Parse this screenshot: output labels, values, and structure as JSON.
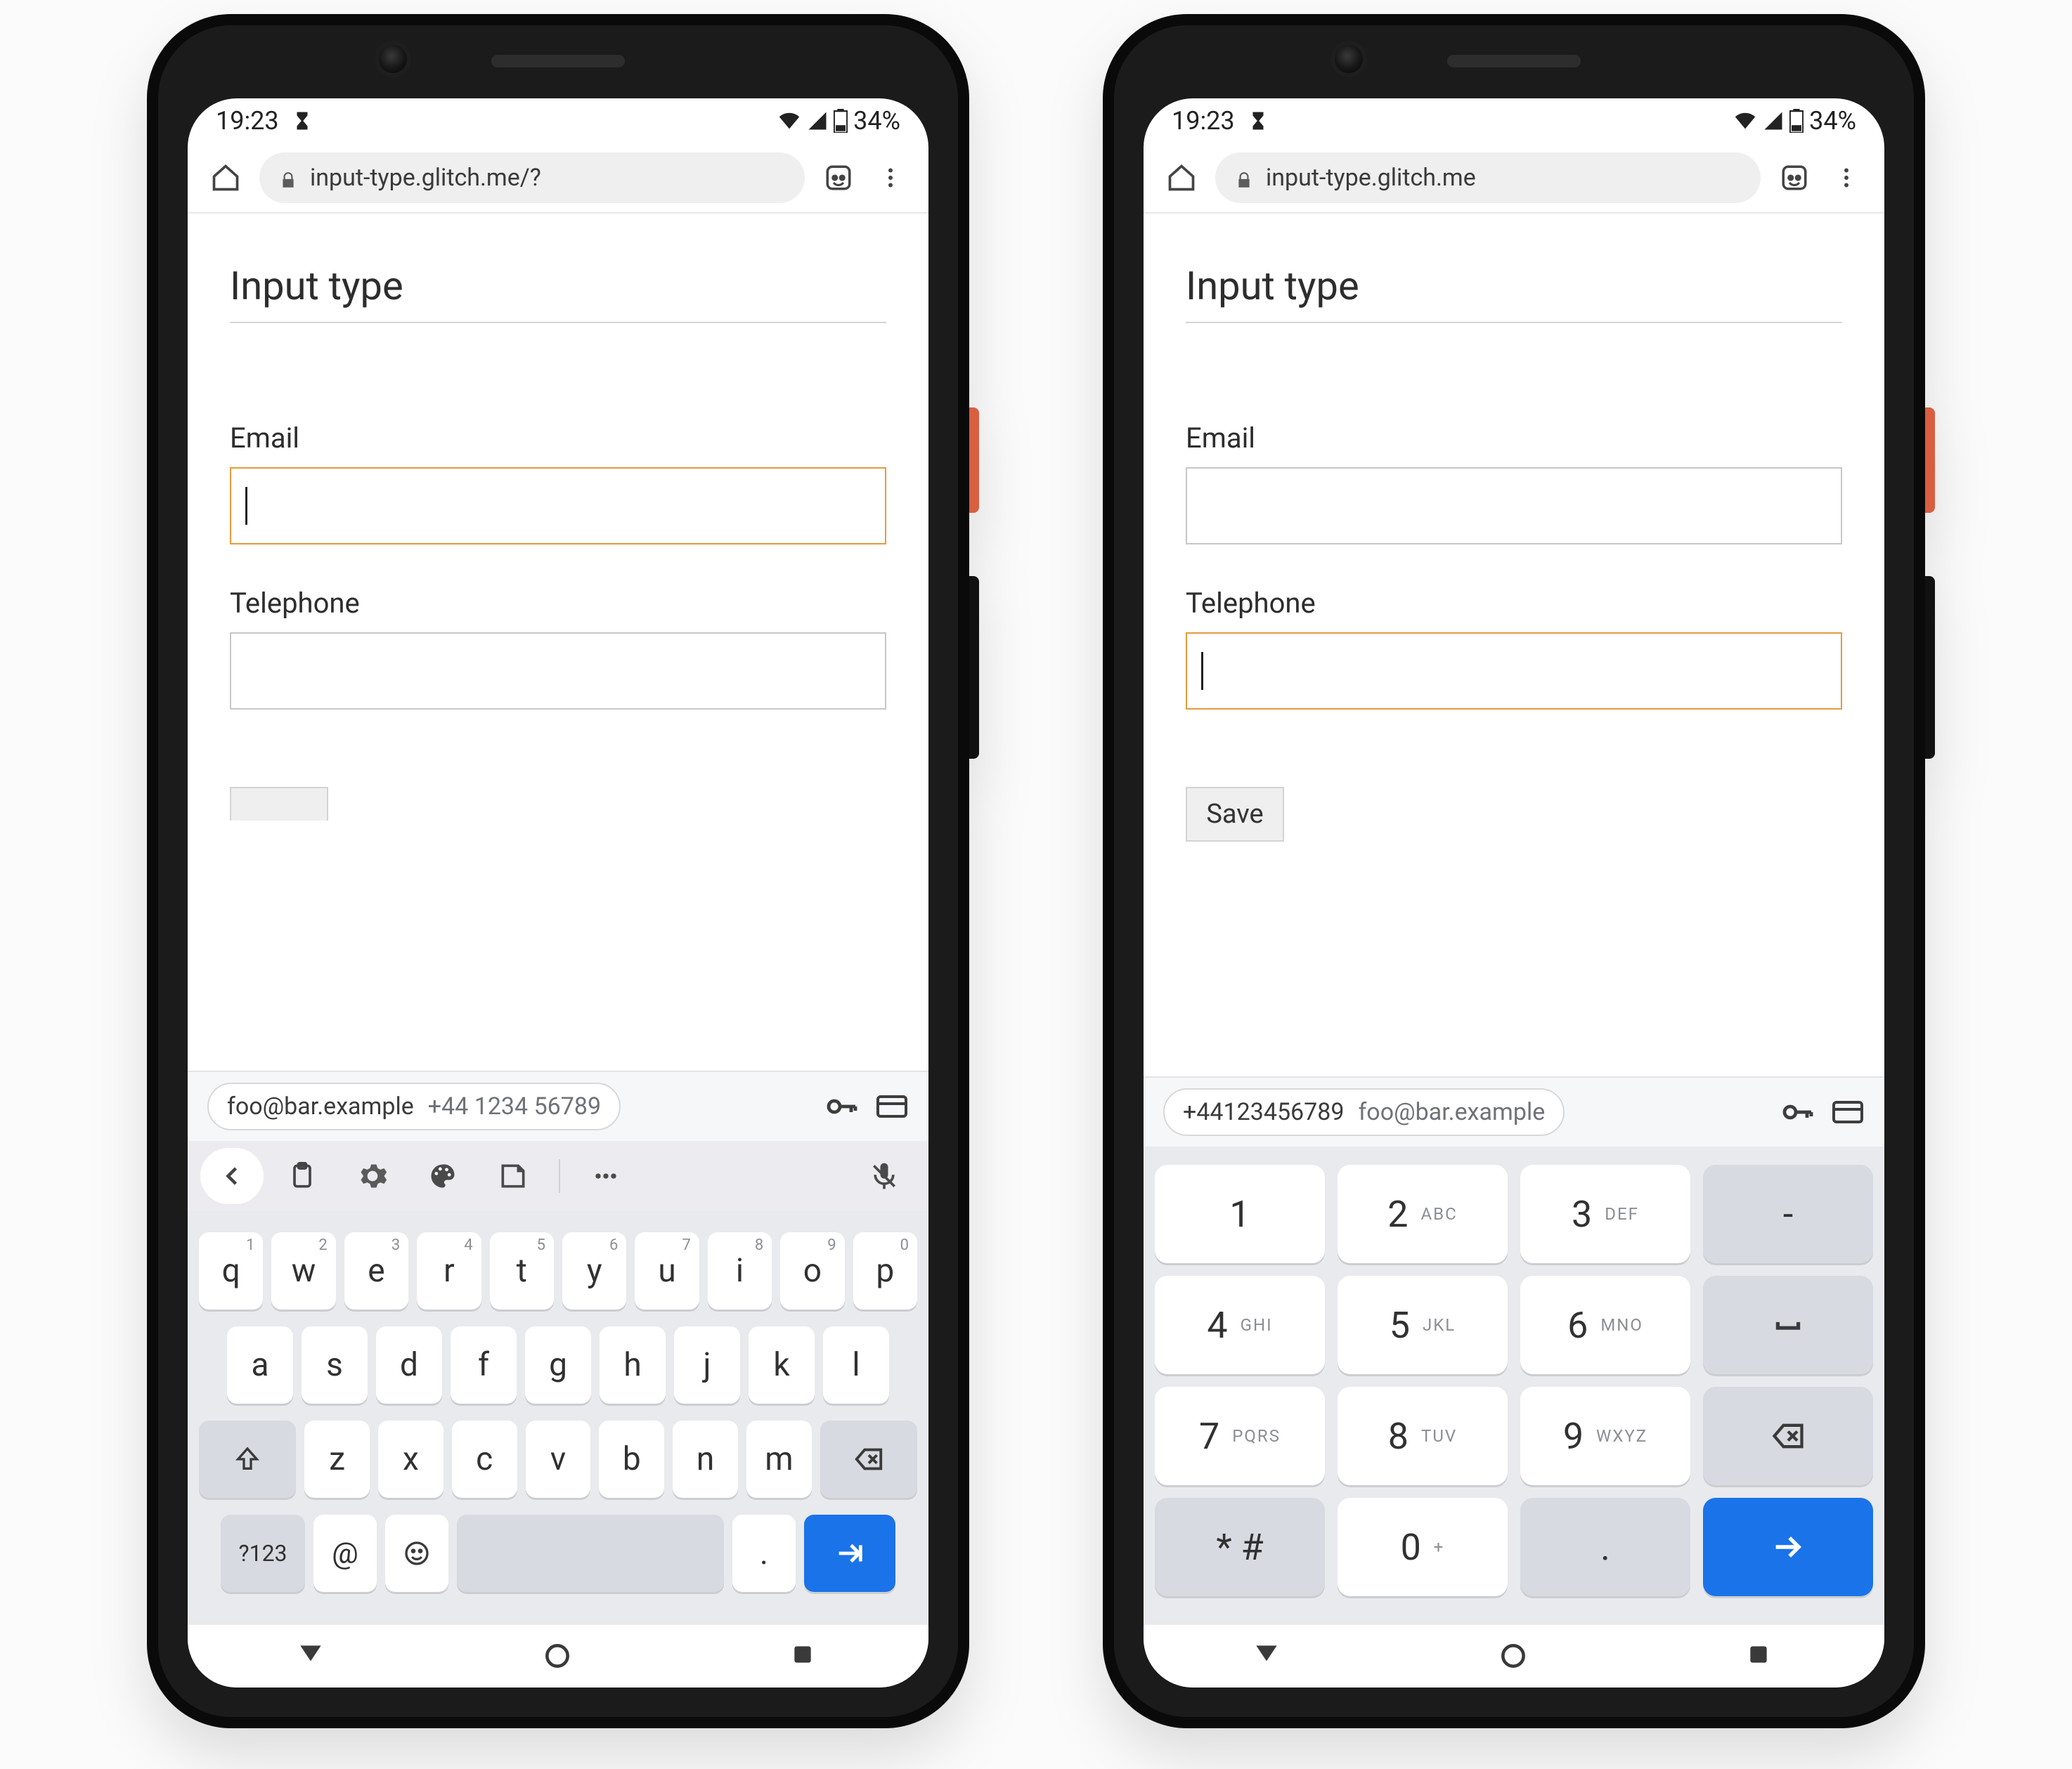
{
  "status": {
    "time": "19:23",
    "battery": "34%"
  },
  "browser": {
    "url_left": "input-type.glitch.me/?",
    "url_right": "input-type.glitch.me"
  },
  "page": {
    "heading": "Input type",
    "email_label": "Email",
    "tel_label": "Telephone",
    "save_label": "Save"
  },
  "autofill": {
    "email_chip_primary": "foo@bar.example",
    "email_chip_secondary": "+44 1234 56789",
    "tel_chip_primary": "+44123456789",
    "tel_chip_secondary": "foo@bar.example"
  },
  "qwerty": {
    "row1": [
      {
        "k": "q",
        "s": "1"
      },
      {
        "k": "w",
        "s": "2"
      },
      {
        "k": "e",
        "s": "3"
      },
      {
        "k": "r",
        "s": "4"
      },
      {
        "k": "t",
        "s": "5"
      },
      {
        "k": "y",
        "s": "6"
      },
      {
        "k": "u",
        "s": "7"
      },
      {
        "k": "i",
        "s": "8"
      },
      {
        "k": "o",
        "s": "9"
      },
      {
        "k": "p",
        "s": "0"
      }
    ],
    "row2": [
      "a",
      "s",
      "d",
      "f",
      "g",
      "h",
      "j",
      "k",
      "l"
    ],
    "row3": [
      "z",
      "x",
      "c",
      "v",
      "b",
      "n",
      "m"
    ],
    "opt": "?123",
    "at": "@",
    "dot": "."
  },
  "numpad": {
    "rows": [
      [
        {
          "n": "1",
          "s": ""
        },
        {
          "n": "2",
          "s": "ABC"
        },
        {
          "n": "3",
          "s": "DEF"
        },
        {
          "n": "-",
          "s": "",
          "fn": true
        }
      ],
      [
        {
          "n": "4",
          "s": "GHI"
        },
        {
          "n": "5",
          "s": "JKL"
        },
        {
          "n": "6",
          "s": "MNO"
        },
        {
          "icon": "space",
          "fn": true
        }
      ],
      [
        {
          "n": "7",
          "s": "PQRS"
        },
        {
          "n": "8",
          "s": "TUV"
        },
        {
          "n": "9",
          "s": "WXYZ"
        },
        {
          "icon": "bsp",
          "fn": true
        }
      ],
      [
        {
          "n": "* #",
          "s": "",
          "fn": true
        },
        {
          "n": "0",
          "s": "+"
        },
        {
          "n": ".",
          "s": "",
          "fn": true
        },
        {
          "icon": "go",
          "go": true
        }
      ]
    ]
  }
}
